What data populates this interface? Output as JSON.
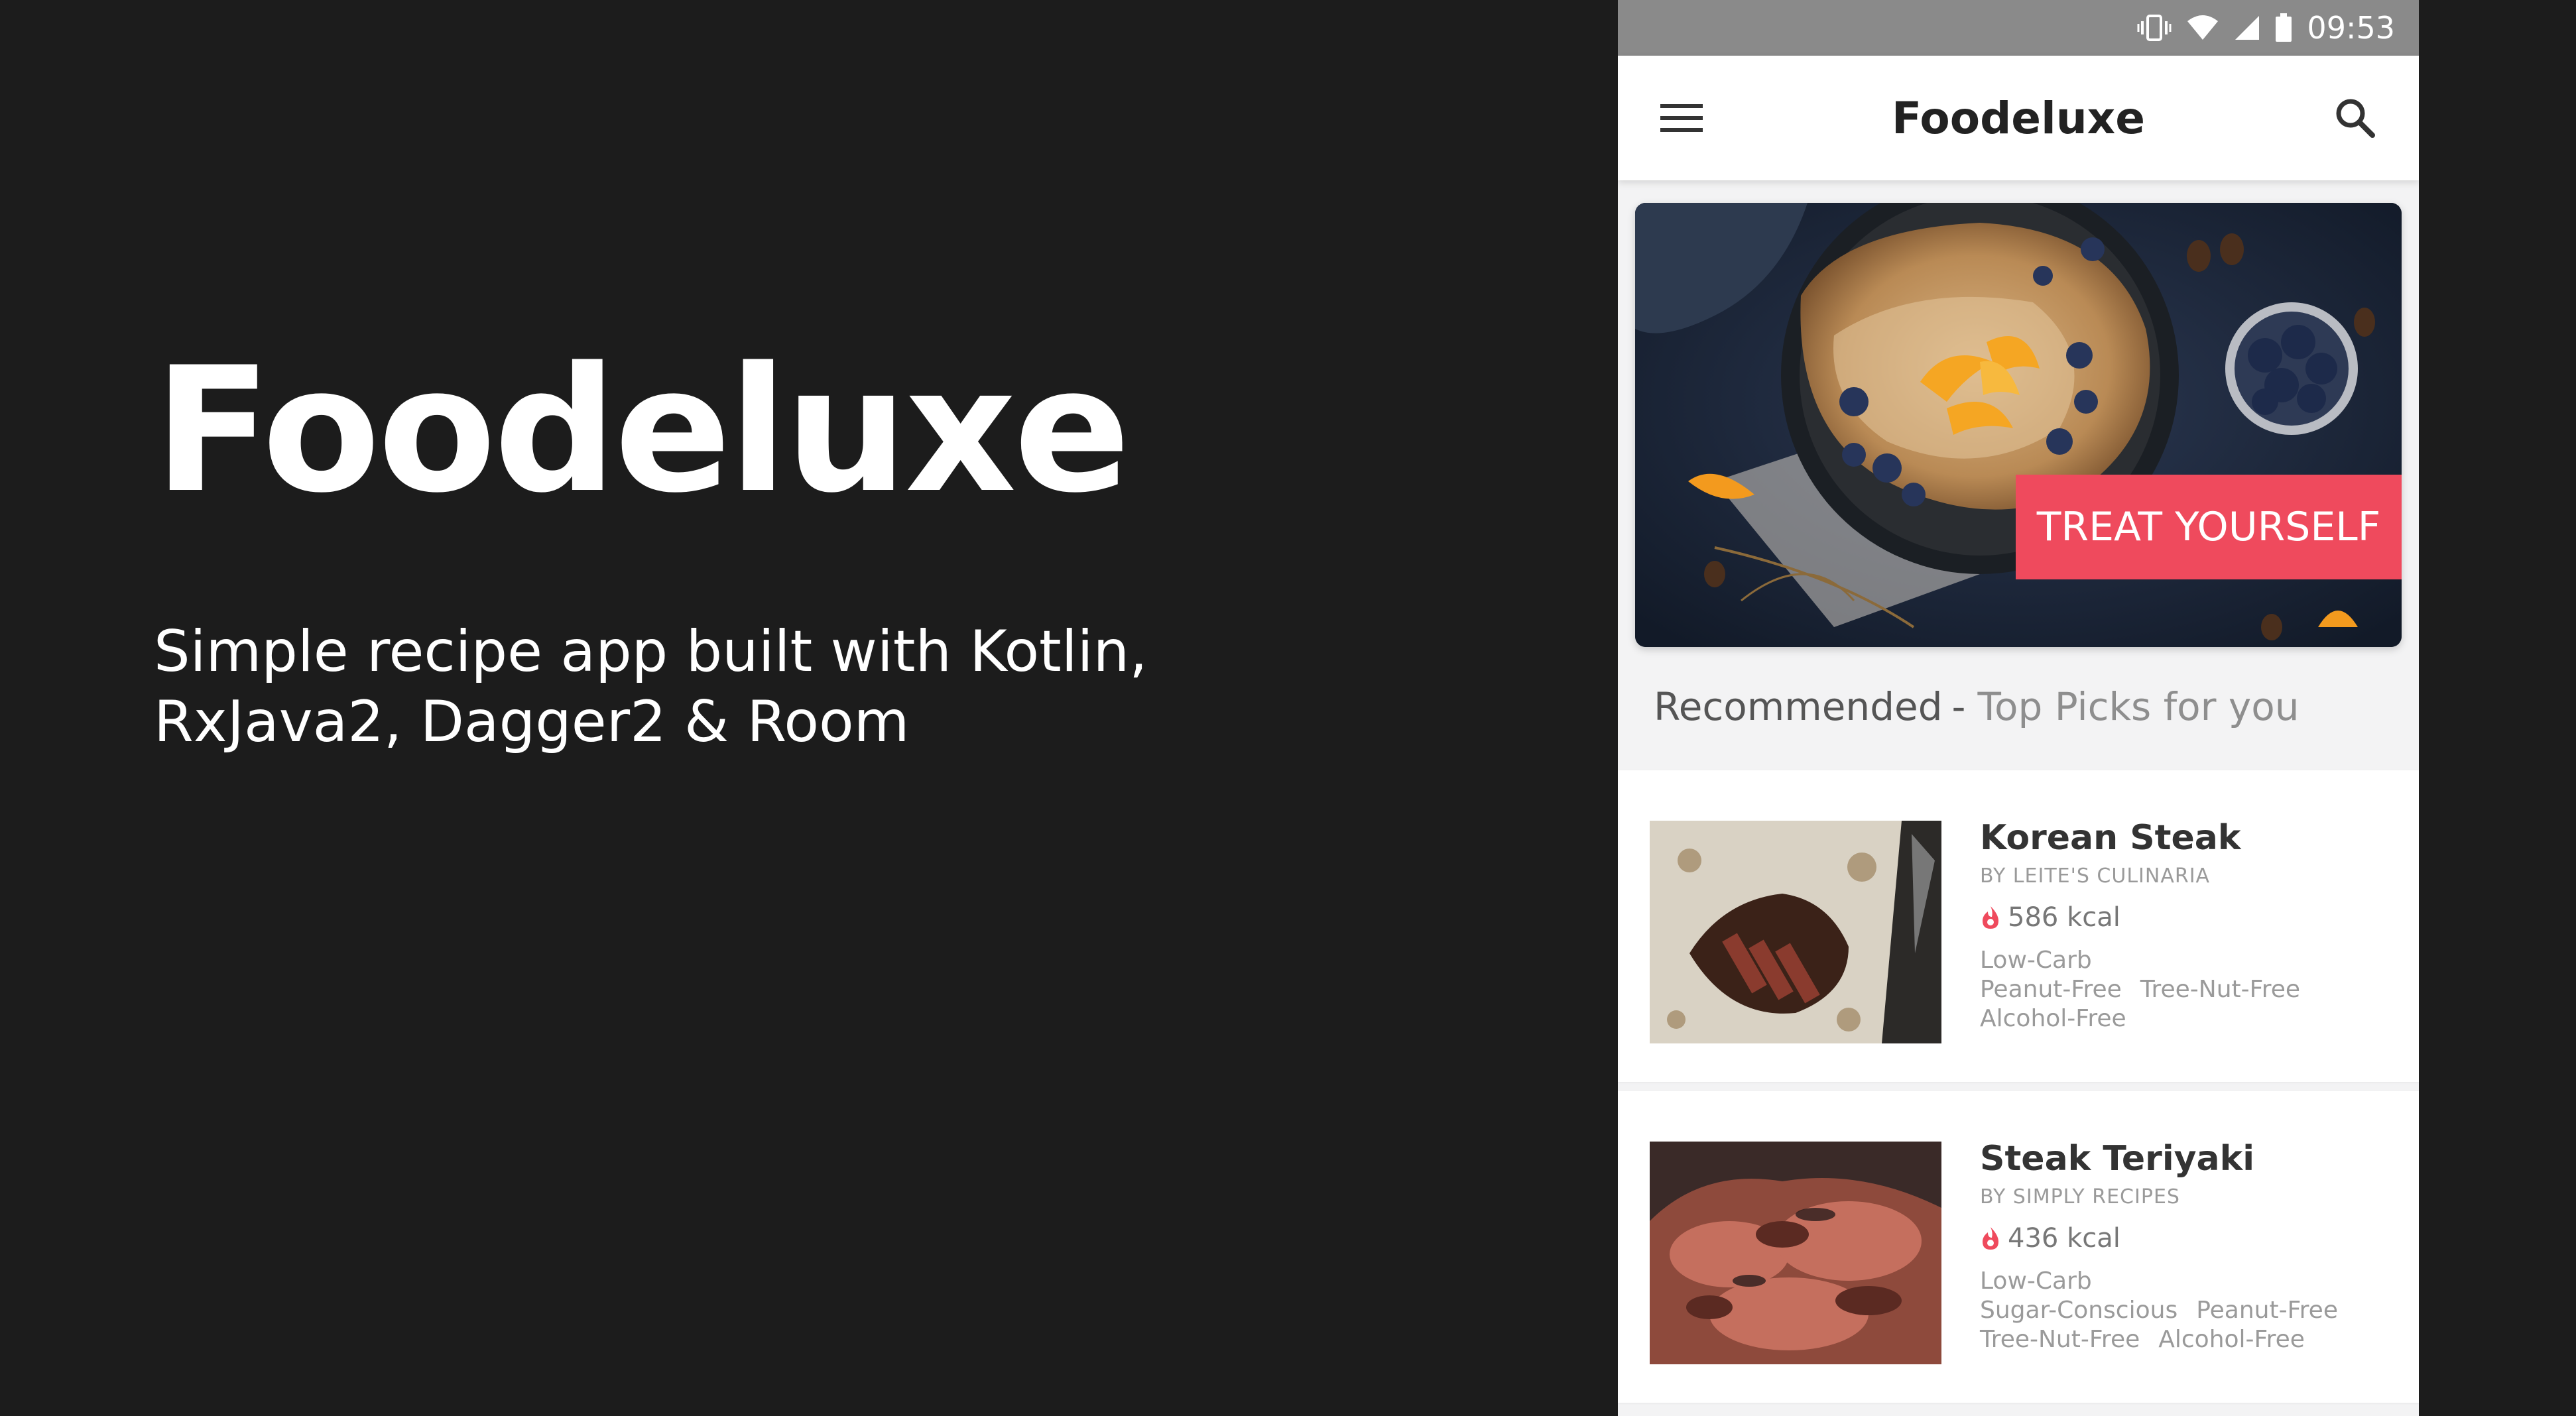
{
  "promo": {
    "title": "Foodeluxe",
    "subtitle_line1": "Simple recipe app built with Kotlin,",
    "subtitle_line2": "RxJava2, Dagger2 & Room"
  },
  "statusbar": {
    "time": "09:53",
    "icons": [
      "vibrate-icon",
      "wifi-icon",
      "signal-icon",
      "battery-icon"
    ]
  },
  "appbar": {
    "title": "Foodeluxe",
    "menu_icon": "hamburger-menu-icon",
    "search_icon": "search-icon"
  },
  "hero": {
    "badge": "TREAT YOURSELF"
  },
  "section": {
    "lead": "Recommended",
    "dash": "-",
    "sub": "Top Picks for you"
  },
  "recipes": [
    {
      "name": "Korean Steak",
      "source": "BY LEITE'S CULINARIA",
      "kcal": "586 kcal",
      "tags_line1": [
        "Low-Carb"
      ],
      "tags_line2": [
        "Peanut-Free",
        "Tree-Nut-Free"
      ],
      "tags_line3": [
        "Alcohol-Free"
      ]
    },
    {
      "name": "Steak Teriyaki",
      "source": "BY SIMPLY RECIPES",
      "kcal": "436 kcal",
      "tags_line1": [
        "Low-Carb"
      ],
      "tags_line2": [
        "Sugar-Conscious",
        "Peanut-Free"
      ],
      "tags_line3": [
        "Tree-Nut-Free",
        "Alcohol-Free"
      ]
    }
  ],
  "colors": {
    "background": "#1c1c1c",
    "accent": "#ef4a5d",
    "statusbar": "#8a8a8a"
  }
}
